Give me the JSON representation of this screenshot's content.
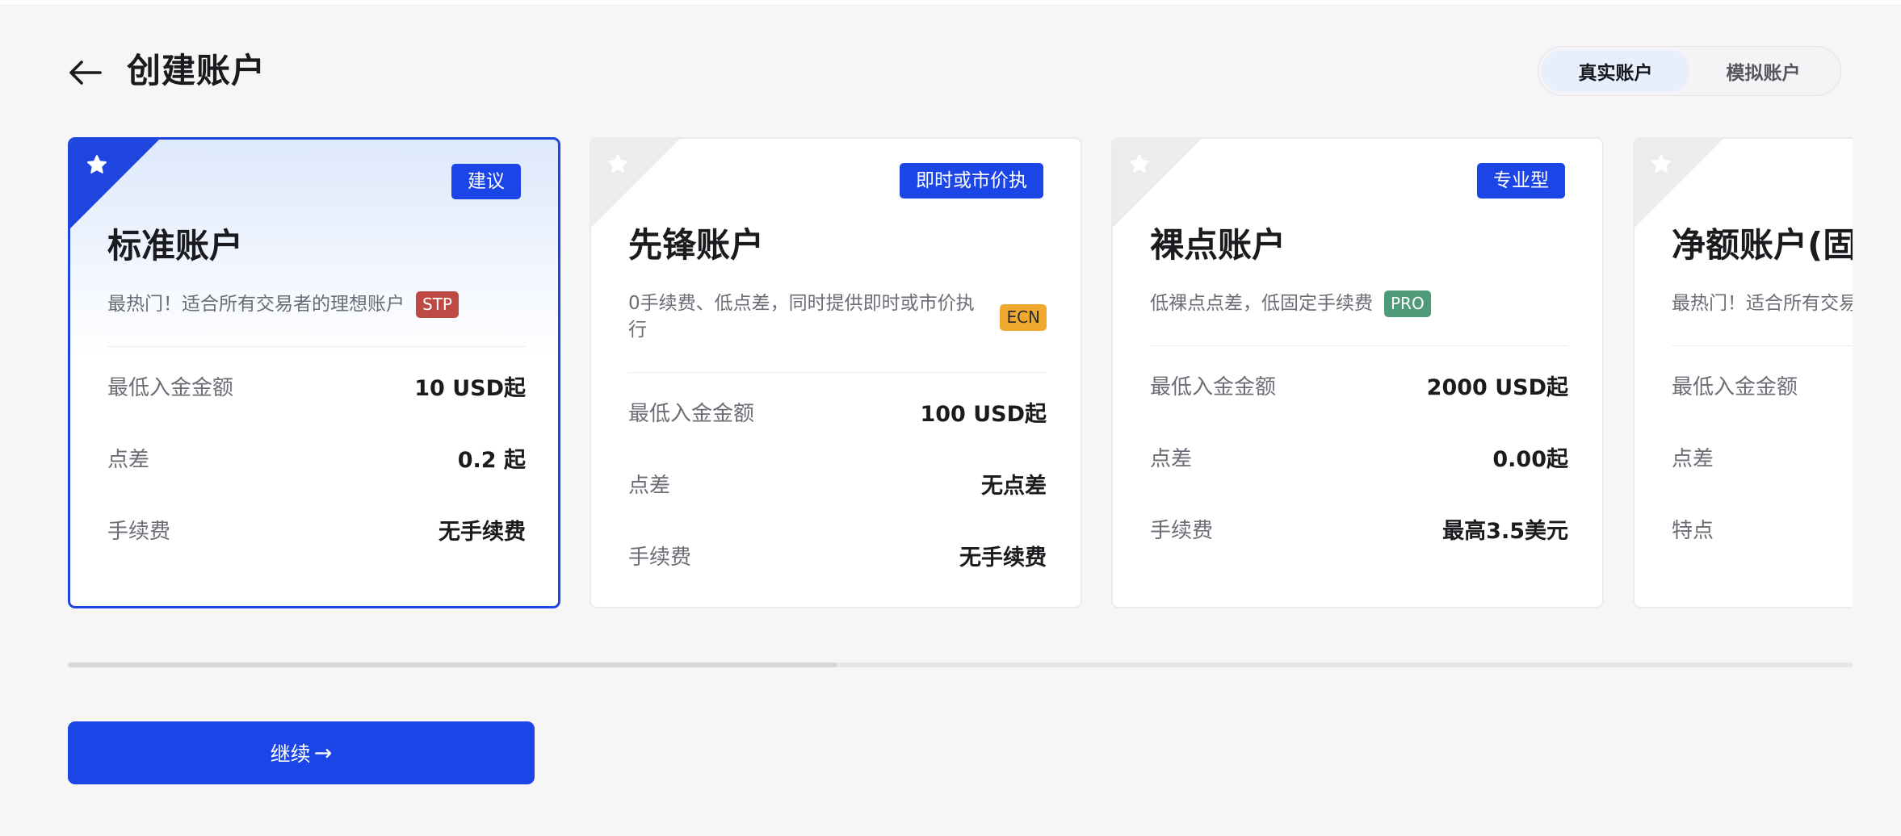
{
  "header": {
    "title": "创建账户",
    "back_icon": "arrow-left-icon"
  },
  "account_mode": {
    "options": [
      "真实账户",
      "模拟账户"
    ],
    "selected": "真实账户"
  },
  "cards": [
    {
      "name": "标准账户",
      "tag": "建议",
      "desc": "最热门！适合所有交易者的理想账户",
      "badge": "STP",
      "badge_color": "#bd4a45",
      "selected": true,
      "rows": [
        {
          "label": "最低入金金额",
          "value": "10 USD起"
        },
        {
          "label": "点差",
          "value": "0.2 起"
        },
        {
          "label": "手续费",
          "value": "无手续费"
        }
      ]
    },
    {
      "name": "先锋账户",
      "tag": "即时或市价执",
      "desc": "0手续费、低点差，同时提供即时或市价执行",
      "badge": "ECN",
      "badge_color": "#f0a92f",
      "selected": false,
      "rows": [
        {
          "label": "最低入金金额",
          "value": "100 USD起"
        },
        {
          "label": "点差",
          "value": "无点差"
        },
        {
          "label": "手续费",
          "value": "无手续费"
        }
      ]
    },
    {
      "name": "裸点账户",
      "tag": "专业型",
      "desc": "低裸点点差，低固定手续费",
      "badge": "PRO",
      "badge_color": "#4f9a78",
      "selected": false,
      "rows": [
        {
          "label": "最低入金金额",
          "value": "2000 USD起"
        },
        {
          "label": "点差",
          "value": "0.00起"
        },
        {
          "label": "手续费",
          "value": "最高3.5美元"
        }
      ]
    },
    {
      "name": "净额账户(固定点差)",
      "tag": "",
      "desc": "最热门！适合所有交易者的理想账户",
      "badge": "",
      "badge_color": "",
      "selected": false,
      "rows": [
        {
          "label": "最低入金金额",
          "value": ""
        },
        {
          "label": "点差",
          "value": ""
        },
        {
          "label": "特点",
          "value": ""
        }
      ]
    }
  ],
  "scroll": {
    "position": 0.43
  },
  "continue_button": {
    "label": "继续",
    "icon": "arrow-right-icon"
  },
  "colors": {
    "primary": "#1b45e7",
    "selected_border": "#1f45df",
    "page_bg": "#f6f6f6"
  }
}
